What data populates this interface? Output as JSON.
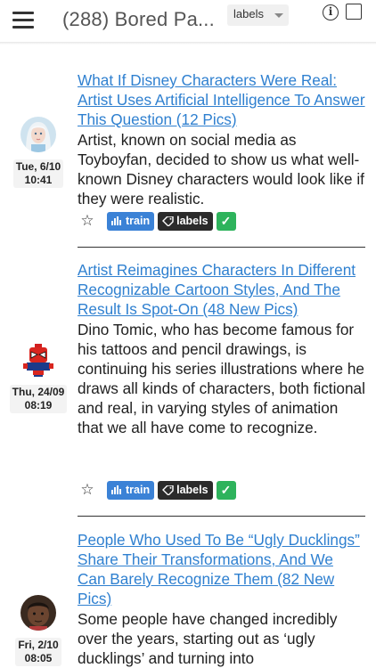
{
  "header": {
    "title": "(288) Bored Pa...",
    "labels_select": "labels",
    "menu_icon": "hamburger-menu-icon",
    "info_icon": "info-icon",
    "info_glyph": "i",
    "checkbox_icon": "checkbox-unchecked-icon"
  },
  "actions": {
    "star": "☆",
    "train_label": "train",
    "labels_label": "labels",
    "check_glyph": "✓",
    "colors": {
      "train": "#3b82d6",
      "labels": "#2b2b2b",
      "check": "#2eb35c",
      "link": "#2f80d0"
    }
  },
  "articles": [
    {
      "title": "What If Disney Characters Were Real: Artist Uses Artificial Intelligence To Answer This Question (12 Pics)",
      "summary": "Artist, known on social media as Toyboyfan, decided to show us what well-known Disney characters would look like if they were realistic.",
      "date": "Tue, 6/10",
      "time": "10:41",
      "avatar": "woman-portrait-avatar"
    },
    {
      "title": "Artist Reimagines Characters In Different Recognizable Cartoon Styles, And The Result Is Spot-On (48 New Pics)",
      "summary": "Dino Tomic, who has become famous for his tattoos and pencil drawings, is continuing his series illustrations where he draws all kinds of characters, both fictional and real, in varying styles of animation that we all have come to recognize.",
      "date": "Thu, 24/09",
      "time": "08:19",
      "avatar": "lego-spiderman-avatar"
    },
    {
      "title": "People Who Used To Be “Ugly Ducklings” Share Their Transformations, And We Can Barely Recognize Them (82 New Pics)",
      "summary": "Some people have changed incredibly over the years, starting out as ‘ugly ducklings’ and turning into",
      "date": "Fri, 2/10",
      "time": "08:05",
      "avatar": "child-portrait-avatar"
    }
  ]
}
